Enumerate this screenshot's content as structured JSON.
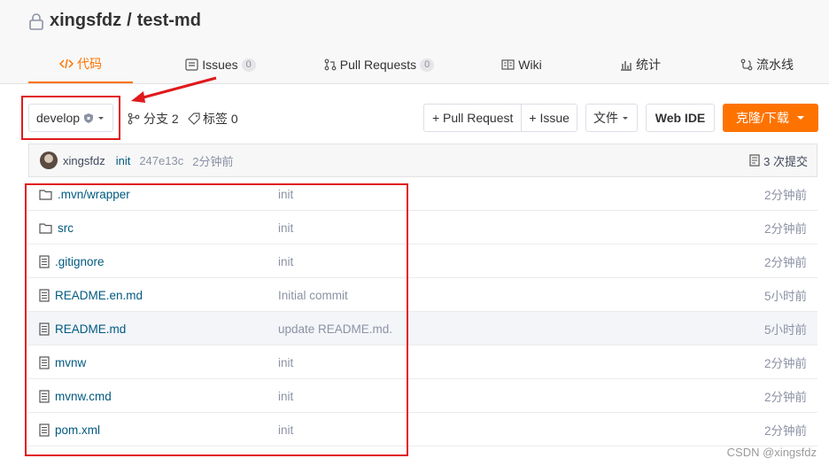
{
  "repo": {
    "owner": "xingsfdz",
    "separator": "/",
    "name": "test-md"
  },
  "tabs": [
    {
      "label": "代码",
      "icon": "code-icon",
      "active": true
    },
    {
      "label": "Issues",
      "count": "0",
      "icon": "issues-icon"
    },
    {
      "label": "Pull Requests",
      "count": "0",
      "icon": "pull-request-icon"
    },
    {
      "label": "Wiki",
      "icon": "wiki-icon"
    },
    {
      "label": "统计",
      "icon": "stats-icon"
    },
    {
      "label": "流水线",
      "icon": "pipeline-icon"
    }
  ],
  "toolbar": {
    "branch": "develop",
    "branches_label": "分支 2",
    "tags_label": "标签 0",
    "pr_button": "+ Pull Request",
    "issue_button": "+ Issue",
    "file_button": "文件",
    "webide_button": "Web IDE",
    "clone_button": "克隆/下载"
  },
  "commit": {
    "author": "xingsfdz",
    "message": "init",
    "hash": "247e13c",
    "time": "2分钟前",
    "count_label": "3 次提交"
  },
  "files": [
    {
      "name": ".mvn/wrapper",
      "type": "folder",
      "message": "init",
      "time": "2分钟前"
    },
    {
      "name": "src",
      "type": "folder",
      "message": "init",
      "time": "2分钟前"
    },
    {
      "name": ".gitignore",
      "type": "file",
      "message": "init",
      "time": "2分钟前"
    },
    {
      "name": "README.en.md",
      "type": "file",
      "message": "Initial commit",
      "time": "5小时前"
    },
    {
      "name": "README.md",
      "type": "file",
      "message": "update README.md.",
      "time": "5小时前"
    },
    {
      "name": "mvnw",
      "type": "file",
      "message": "init",
      "time": "2分钟前"
    },
    {
      "name": "mvnw.cmd",
      "type": "file",
      "message": "init",
      "time": "2分钟前"
    },
    {
      "name": "pom.xml",
      "type": "file",
      "message": "init",
      "time": "2分钟前"
    }
  ],
  "watermark": "CSDN @xingsfdz",
  "colors": {
    "accent": "#fe7300",
    "annotation": "#e0191c",
    "link": "#005980"
  }
}
